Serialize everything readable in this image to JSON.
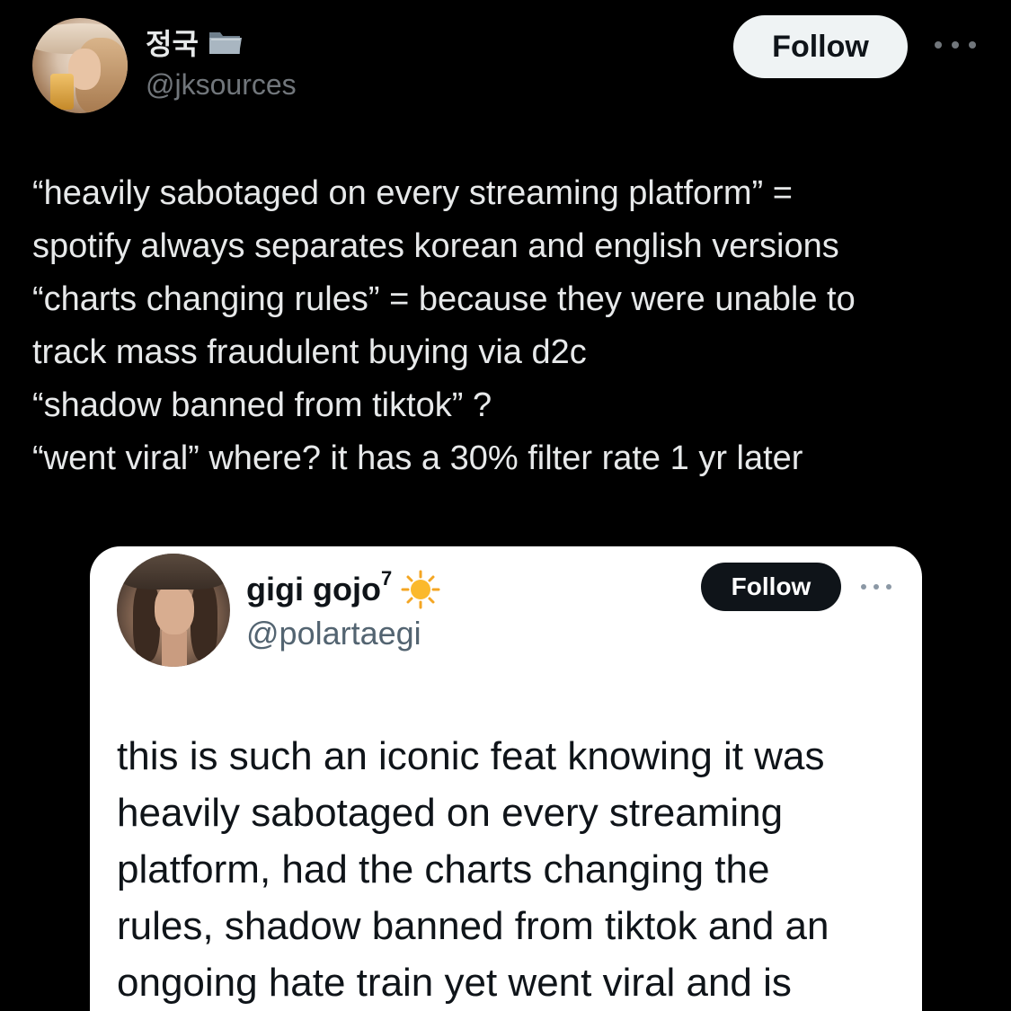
{
  "tweet": {
    "author": {
      "display_name": "정국",
      "badge_icon": "folder-icon",
      "handle": "@jksources"
    },
    "follow_label": "Follow",
    "more_icon": "more-options-icon",
    "text_lines": [
      "“heavily sabotaged on every streaming platform” =",
      "spotify always separates korean and english versions",
      "“charts changing rules” = because they were unable to",
      "track mass fraudulent buying via d2c",
      "“shadow banned from tiktok” ?",
      "“went viral” where? it has a 30% filter rate 1 yr later"
    ]
  },
  "quoted": {
    "author": {
      "display_name": "gigi gojo",
      "superscript": "7",
      "badge_icon": "sun-icon",
      "handle": "@polartaegi"
    },
    "follow_label": "Follow",
    "more_icon": "more-options-icon",
    "text_lines": [
      "this is such an iconic feat knowing it was",
      "heavily sabotaged on every streaming",
      "platform, had the charts changing the",
      "rules, shadow banned from tiktok and an",
      "ongoing hate train yet went viral and is"
    ]
  },
  "colors": {
    "background": "#000000",
    "text_primary": "#e7e9ea",
    "text_secondary": "#71767b",
    "card_background": "#ffffff",
    "card_text": "#0f1419",
    "card_secondary": "#536471"
  }
}
